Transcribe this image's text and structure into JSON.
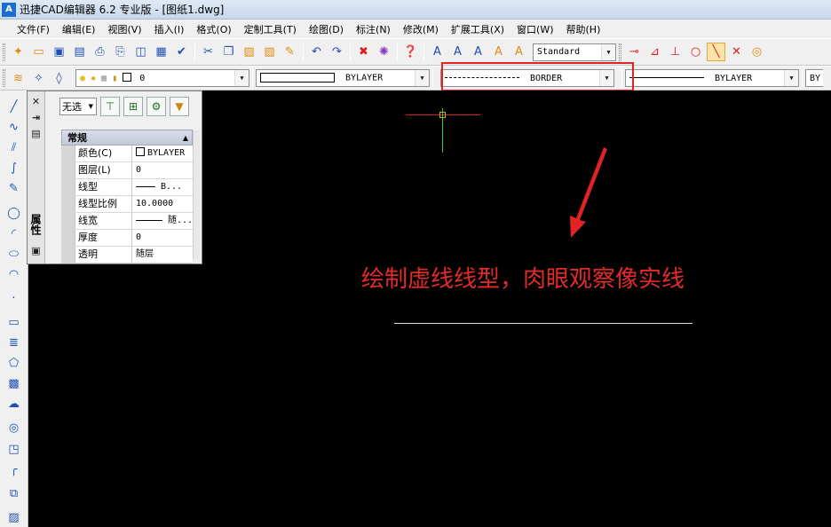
{
  "window": {
    "title": "迅捷CAD编辑器 6.2 专业版  - [图纸1.dwg]",
    "icon_text": "A"
  },
  "menu": [
    "文件(F)",
    "编辑(E)",
    "视图(V)",
    "插入(I)",
    "格式(O)",
    "定制工具(T)",
    "绘图(D)",
    "标注(N)",
    "修改(M)",
    "扩展工具(X)",
    "窗口(W)",
    "帮助(H)"
  ],
  "toolbar1": {
    "text_style": "Standard"
  },
  "toolbar2": {
    "layer_value": "0",
    "color_value": "BYLAYER",
    "linetype_value": "BORDER",
    "lineweight_value": "BYLAYER",
    "extra_value": "BY"
  },
  "properties_panel": {
    "tab_label": "属性",
    "selection": "无选",
    "section_title": "常规",
    "rows": [
      {
        "key": "颜色(C)",
        "value": "BYLAYER"
      },
      {
        "key": "图层(L)",
        "value": "0"
      },
      {
        "key": "线型",
        "value": "B..."
      },
      {
        "key": "线型比例",
        "value": "10.0000"
      },
      {
        "key": "线宽",
        "value": "随..."
      },
      {
        "key": "厚度",
        "value": "0"
      },
      {
        "key": "透明",
        "value": "随层"
      }
    ]
  },
  "canvas": {
    "annotation": "绘制虚线线型，肉眼观察像实线",
    "annotation_color": "#e42a2a",
    "highlight_color": "#e02424"
  }
}
